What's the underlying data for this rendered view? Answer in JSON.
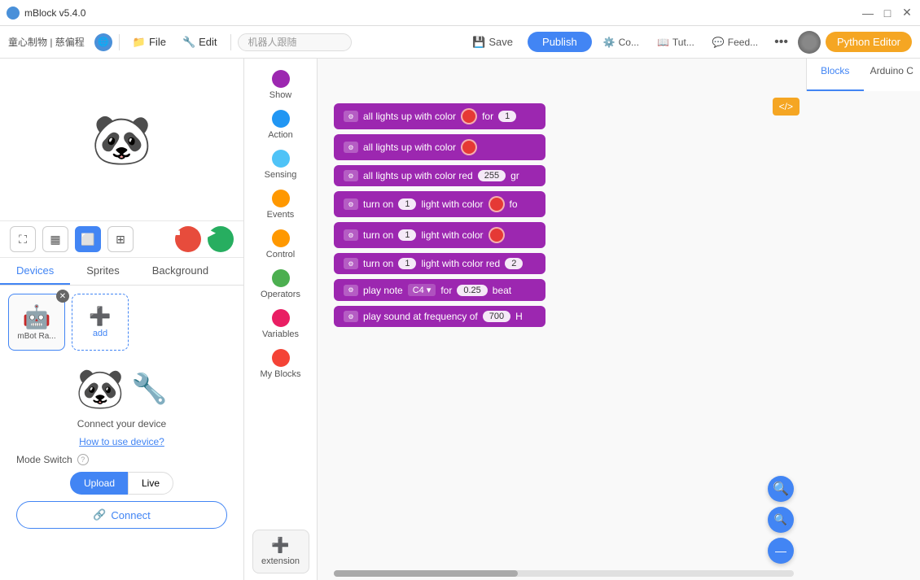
{
  "app": {
    "title": "mBlock v5.4.0",
    "version": "v5.4.0"
  },
  "titlebar": {
    "title": "mBlock v5.4.0",
    "minimize": "—",
    "maximize": "□",
    "close": "✕"
  },
  "menubar": {
    "brand": "童心制物 | 慈偏程",
    "file_label": "File",
    "edit_label": "Edit",
    "search_placeholder": "机器人跟随",
    "save_label": "Save",
    "publish_label": "Publish",
    "co_label": "Co...",
    "tut_label": "Tut...",
    "feed_label": "Feed...",
    "more_label": "•••",
    "python_label": "Python Editor"
  },
  "right_tabs": {
    "blocks_label": "Blocks",
    "arduino_label": "Arduino C"
  },
  "block_categories": [
    {
      "id": "show",
      "label": "Show",
      "color": "#9c27b0"
    },
    {
      "id": "action",
      "label": "Action",
      "color": "#2196f3"
    },
    {
      "id": "sensing",
      "label": "Sensing",
      "color": "#4fc3f7"
    },
    {
      "id": "events",
      "label": "Events",
      "color": "#ff9800"
    },
    {
      "id": "control",
      "label": "Control",
      "color": "#ff9800"
    },
    {
      "id": "operators",
      "label": "Operators",
      "color": "#4caf50"
    },
    {
      "id": "variables",
      "label": "Variables",
      "color": "#e91e63"
    },
    {
      "id": "myblocks",
      "label": "My Blocks",
      "color": "#f44336"
    }
  ],
  "extension_label": "extension",
  "code_blocks": [
    {
      "id": "b1",
      "text": "all lights up with color",
      "has_color_circle": true,
      "has_for": true,
      "for_value": "1",
      "type": "all_color_for"
    },
    {
      "id": "b2",
      "text": "all lights up with color",
      "has_color_circle": true,
      "type": "all_color"
    },
    {
      "id": "b3",
      "text": "all lights up with color red",
      "has_values": true,
      "val1": "255",
      "val2": "gr",
      "type": "all_color_red"
    },
    {
      "id": "b4",
      "text": "turn on",
      "num": "1",
      "sub": "light with color",
      "has_color_circle": true,
      "has_for": true,
      "type": "turn_on_color_for"
    },
    {
      "id": "b5",
      "text": "turn on",
      "num": "1",
      "sub": "light with color",
      "has_color_circle": true,
      "type": "turn_on_color"
    },
    {
      "id": "b6",
      "text": "turn on",
      "num": "1",
      "sub": "light with color red",
      "val": "2",
      "type": "turn_on_color_red"
    },
    {
      "id": "b7",
      "text": "play note",
      "note": "C4",
      "for_label": "for",
      "beat": "0.25",
      "beat_label": "beat",
      "type": "play_note"
    },
    {
      "id": "b8",
      "text": "play sound at frequency of",
      "freq": "700",
      "unit": "H",
      "type": "play_freq"
    }
  ],
  "left": {
    "tabs": [
      "Devices",
      "Sprites",
      "Background"
    ],
    "active_tab": "Devices",
    "device_name": "mBot Ra...",
    "add_label": "add",
    "connect_text": "Connect your device",
    "how_to": "How to use device?",
    "mode_switch": "Mode Switch",
    "upload_label": "Upload",
    "live_label": "Live",
    "connect_btn": "Connect"
  }
}
